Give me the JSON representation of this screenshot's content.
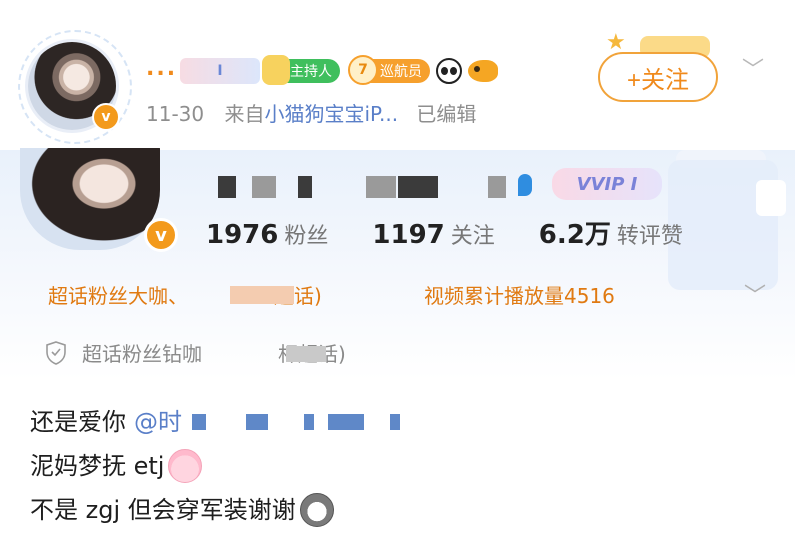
{
  "header": {
    "username": "...",
    "badges": {
      "i_badge": "I",
      "host": "主持人",
      "cruise_level": "7",
      "cruise": "巡航员"
    },
    "meta": {
      "date": "11-30",
      "from_prefix": "来自",
      "source": "小猫狗宝宝iP...",
      "edited": "已编辑"
    },
    "follow_button": "+关注",
    "more_icon": "chevron-down-icon"
  },
  "card": {
    "vvip": "VVIP I",
    "stats": [
      {
        "value": "1976",
        "label": "粉丝"
      },
      {
        "value": "1197",
        "label": "关注"
      },
      {
        "value": "6.2万",
        "label": "转评赞"
      }
    ],
    "honor_left": "超话粉丝大咖",
    "honor_left_suffix": "超话)",
    "honor_right": "视频累计播放量4516",
    "honor_shield": "超话粉丝钻咖",
    "honor_shield_suffix": "杆超话)"
  },
  "post": {
    "line1": "还是爱你",
    "mention": "@时",
    "line2": "泥妈梦抚 etj",
    "line3": "不是 zgj 但会穿军装谢谢"
  },
  "colors": {
    "accent_orange": "#f08a1c",
    "link_blue": "#5a7fc8",
    "host_green": "#3fbf5d"
  }
}
